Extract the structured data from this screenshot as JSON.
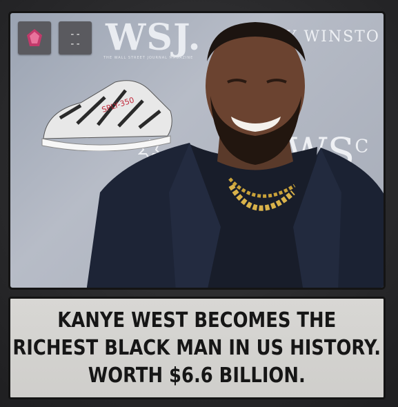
{
  "photo": {
    "backdrop_wordmark": "WSJ.",
    "backdrop_tagline": "THE WALL STREET JOURNAL MAGAZINE",
    "backdrop_brand": "Y WINSTO",
    "backdrop_mark": "WS",
    "backdrop_mark_sup": "C",
    "sneaker_text": "SPLY-350"
  },
  "app_chips": {
    "text_chip_top": "--",
    "text_chip_bottom": "--"
  },
  "headline": {
    "line1": "KANYE WEST BECOMES THE",
    "line2": "RICHEST BLACK MAN IN US HISTORY.",
    "line3": "WORTH $6.6 BILLION."
  },
  "colors": {
    "background": "#2b2b2d",
    "caption_panel": "#d6d5d2",
    "headline_text": "#161616",
    "jacket": "#1d2436",
    "app_icon_accent": "#c23a6b"
  }
}
